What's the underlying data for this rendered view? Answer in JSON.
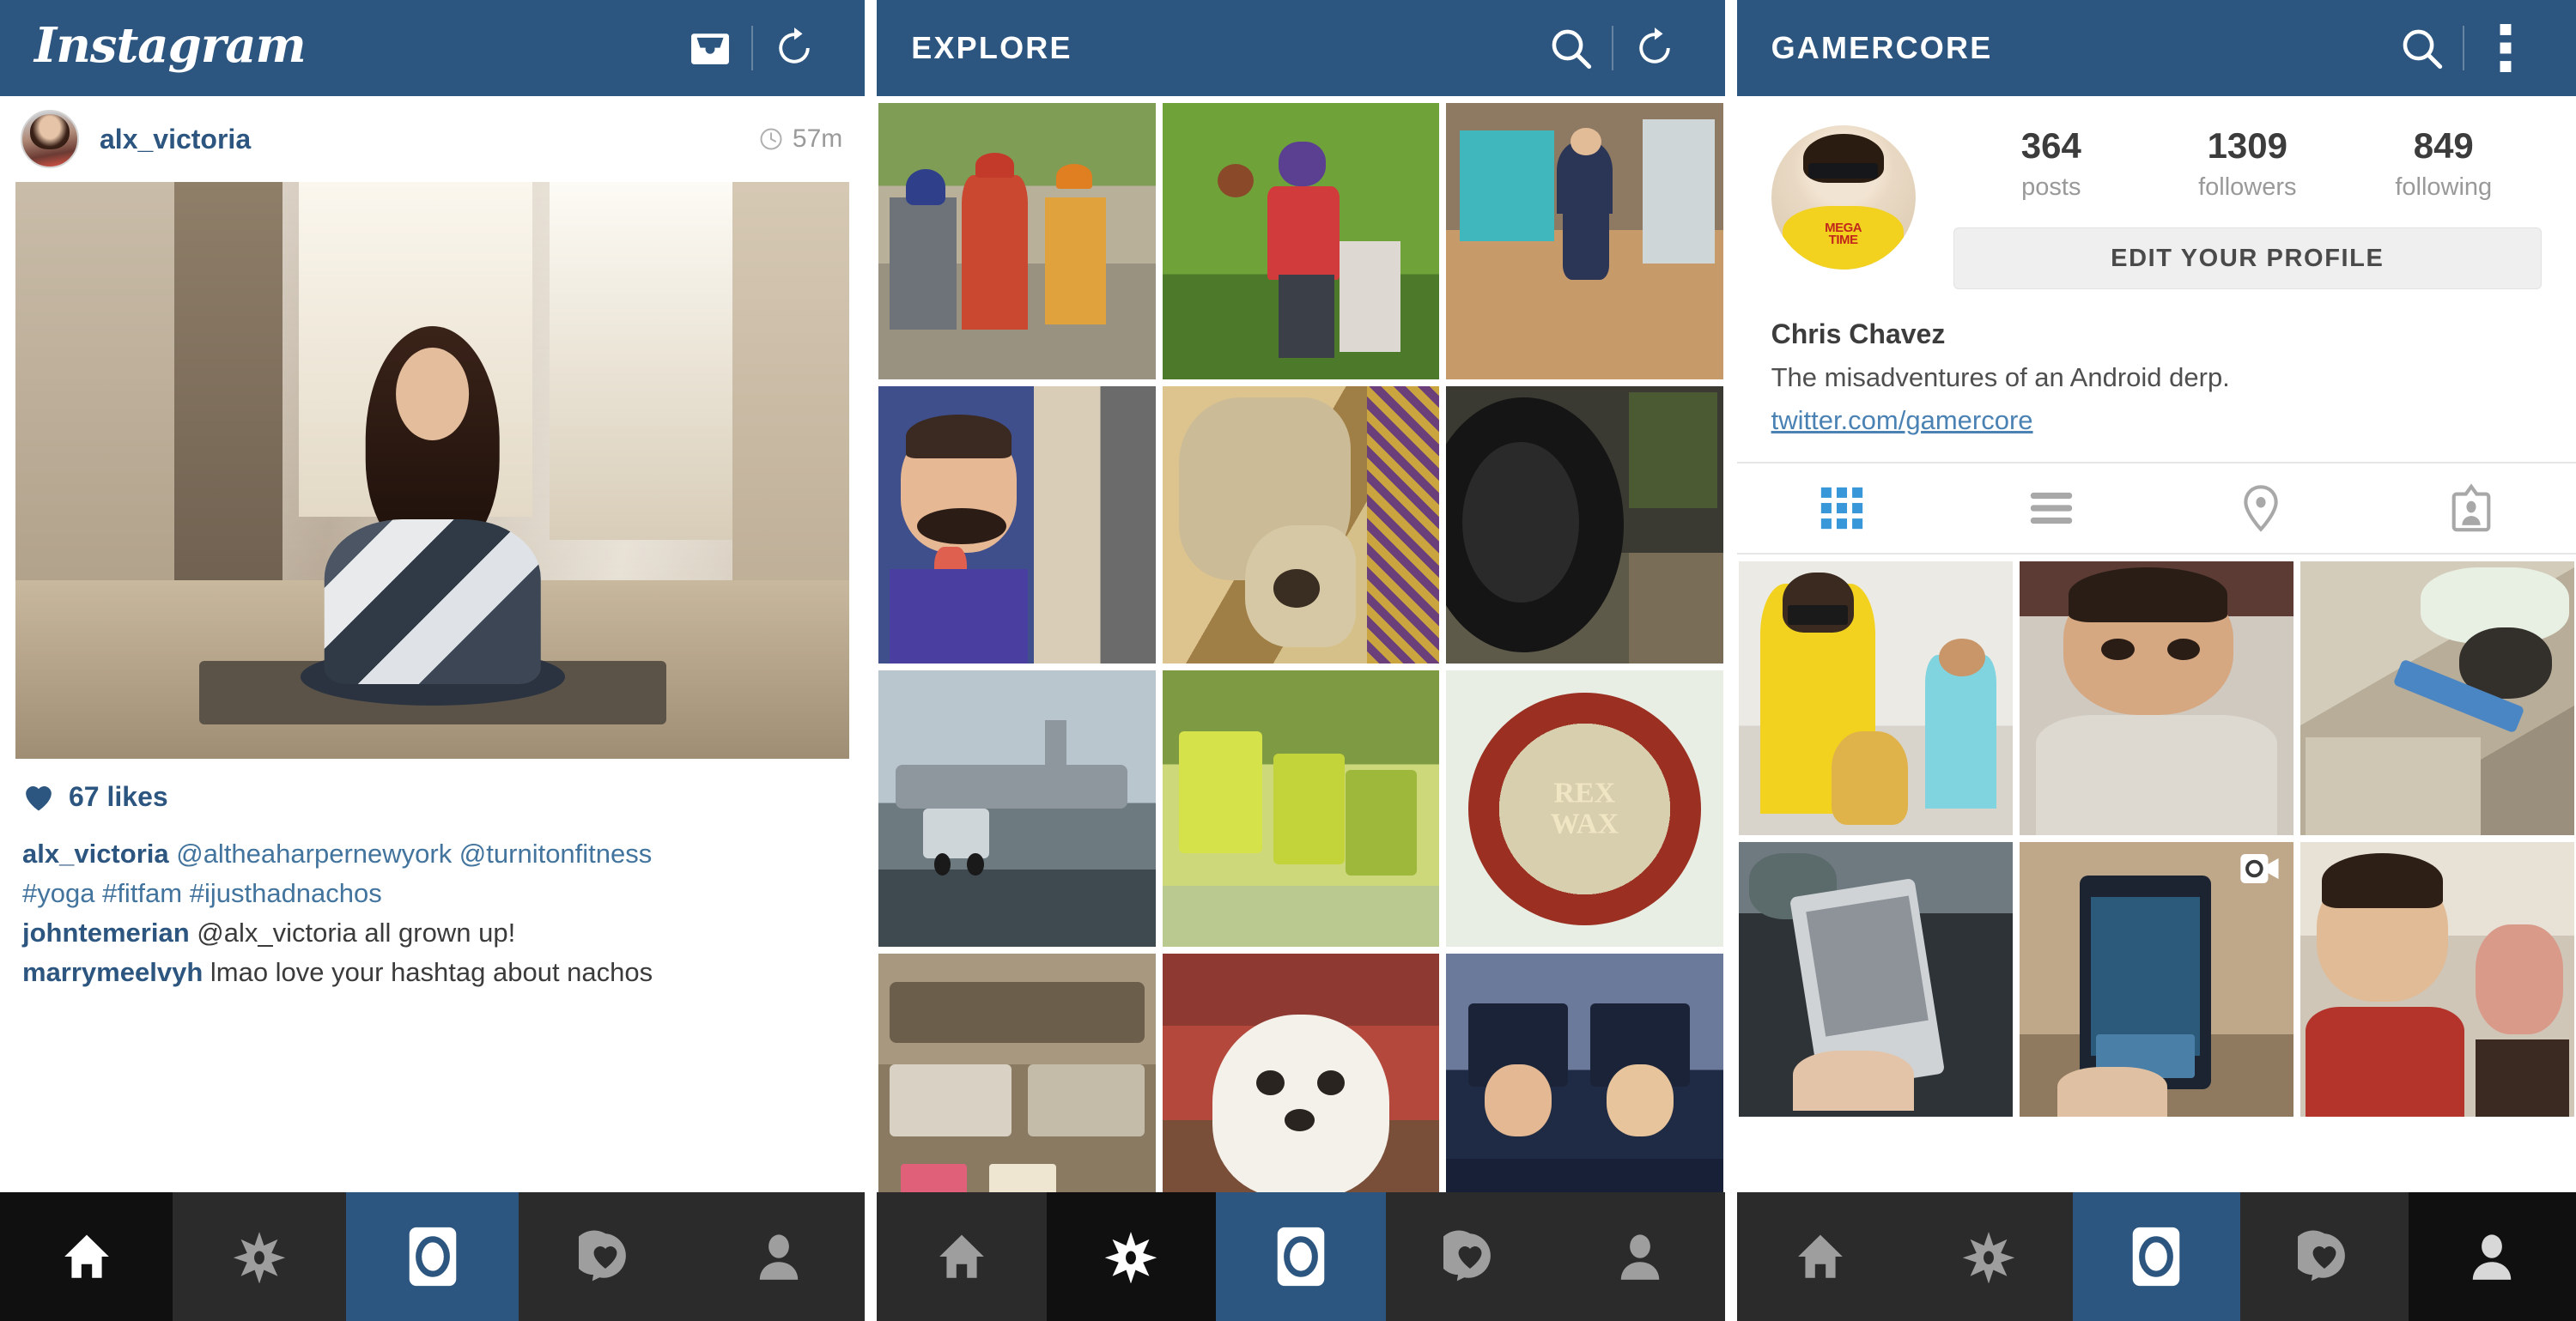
{
  "colors": {
    "appbar_blue": "#2c5680",
    "accent_blue": "#2c5680",
    "link_blue": "#4b82b4",
    "nav_dark": "#2b2b2b",
    "nav_active_dark": "#101010",
    "text_gray": "#4f4f4f",
    "muted_gray": "#999999"
  },
  "feed": {
    "appbar": {
      "logo_text": "Instagram",
      "icons": [
        {
          "name": "inbox-icon",
          "label": "Inbox"
        },
        {
          "name": "refresh-icon",
          "label": "Refresh"
        }
      ]
    },
    "post": {
      "username": "alx_victoria",
      "timestamp": "57m",
      "time_icon": "clock-icon",
      "likes": "67 likes",
      "like_icon": "heart-icon",
      "caption_lines": [
        {
          "user": "alx_victoria",
          "text": " @altheaharpernewyork @turnitonfitness"
        },
        {
          "user": "",
          "text": "#yoga #fitfam #ijusthadnachos"
        },
        {
          "user": "johntemerian",
          "text": " @alx_victoria all grown up!"
        },
        {
          "user": "marrymeelvyh",
          "text": " lmao love your hashtag about nachos"
        }
      ]
    }
  },
  "explore": {
    "appbar": {
      "title": "EXPLORE",
      "icons": [
        {
          "name": "search-icon",
          "label": "Search"
        },
        {
          "name": "refresh-icon",
          "label": "Refresh"
        }
      ]
    },
    "grid": [
      {
        "alt": "man in red shirt with two boys",
        "c1": "#7f9d55",
        "c2": "#c9482f",
        "c3": "#e0a23c"
      },
      {
        "alt": "football player throwing ball",
        "c1": "#5f9133",
        "c2": "#d23b3b",
        "c3": "#5b3f91"
      },
      {
        "alt": "woman in navy skirt by storefront",
        "c1": "#3fb7bd",
        "c2": "#2b3555",
        "c3": "#c79a6a"
      },
      {
        "alt": "man with fake moustache selfie",
        "c1": "#3f4f8c",
        "c2": "#e0c9ae",
        "c3": "#6b6b6b"
      },
      {
        "alt": "pug dog on patterned blanket",
        "c1": "#d9c08a",
        "c2": "#8a6a3a",
        "c3": "#e6d7b4"
      },
      {
        "alt": "black alloy car wheel",
        "c1": "#1c1c1c",
        "c2": "#4b5a32",
        "c3": "#6b6253"
      },
      {
        "alt": "cargo airplane on tarmac",
        "c1": "#9aa7ad",
        "c2": "#47525a",
        "c3": "#cbd3d8"
      },
      {
        "alt": "yellow-green metal patio chairs",
        "c1": "#c9d43f",
        "c2": "#6e8a3a",
        "c3": "#e4e6c9"
      },
      {
        "alt": "Rex Wax moustache wax tin",
        "c1": "#dfe6d9",
        "c2": "#9a2f22",
        "c3": "#c9a43f"
      },
      {
        "alt": "craft supplies tins on shelf",
        "c1": "#b8a88f",
        "c2": "#7a6a54",
        "c3": "#ddd2c0"
      },
      {
        "alt": "white fluffy puppy",
        "c1": "#8e3a33",
        "c2": "#f2efe8",
        "c3": "#c7bfae"
      },
      {
        "alt": "two graduates in caps",
        "c1": "#1f2a44",
        "c2": "#e0b995",
        "c3": "#5b6a85"
      }
    ]
  },
  "profile": {
    "appbar": {
      "title": "GAMERCORE",
      "icons": [
        {
          "name": "search-icon",
          "label": "Search"
        },
        {
          "name": "overflow-menu-icon",
          "label": "More options"
        }
      ]
    },
    "avatar_shirt_line1": "MEGA",
    "avatar_shirt_line2": "TIME",
    "stats": [
      {
        "value": "364",
        "label": "posts"
      },
      {
        "value": "1309",
        "label": "followers"
      },
      {
        "value": "849",
        "label": "following"
      }
    ],
    "edit_profile_label": "EDIT YOUR PROFILE",
    "name": "Chris Chavez",
    "bio": "The misadventures of an Android derp.",
    "website": "twitter.com/gamercore",
    "tabs": [
      {
        "name": "grid-tab",
        "icon": "grid-icon",
        "active": true
      },
      {
        "name": "list-tab",
        "icon": "list-icon",
        "active": false
      },
      {
        "name": "map-tab",
        "icon": "location-pin-icon",
        "active": false
      },
      {
        "name": "photos-of-you-tab",
        "icon": "person-badge-icon",
        "active": false
      }
    ],
    "grid": [
      {
        "alt": "man in yellow shirt with girl and plush",
        "c1": "#f0f0ea",
        "c2": "#f2d21f",
        "c3": "#e8b24a",
        "video": false
      },
      {
        "alt": "man in hospital gown close up",
        "c1": "#6b3a33",
        "c2": "#ddd6cd",
        "c3": "#b99a82",
        "video": false
      },
      {
        "alt": "dog on leash by flower bed",
        "c1": "#cfc6b4",
        "c2": "#3a3a3a",
        "c3": "#4b86c4",
        "video": false
      },
      {
        "alt": "hand holding HTC phone in car",
        "c1": "#3a3a3a",
        "c2": "#c9c9c9",
        "c3": "#8a8a8a",
        "video": false
      },
      {
        "alt": "hand holding Samsung phone",
        "c1": "#b49a7c",
        "c2": "#1f2b3a",
        "c3": "#d8c9b4",
        "video": true
      },
      {
        "alt": "man in red shirt in car with child",
        "c1": "#e8e2d8",
        "c2": "#b4342c",
        "c3": "#3a2a22",
        "video": false
      }
    ],
    "video_badge_icon": "video-camera-icon"
  },
  "bottom_nav": [
    {
      "name": "nav-home",
      "icon": "home-icon",
      "state": "active-dark"
    },
    {
      "name": "nav-explore",
      "icon": "compass-star-icon",
      "state": "normal"
    },
    {
      "name": "nav-camera",
      "icon": "camera-icon",
      "state": "accent"
    },
    {
      "name": "nav-activity",
      "icon": "heart-bubble-icon",
      "state": "normal"
    },
    {
      "name": "nav-profile",
      "icon": "person-icon",
      "state": "normal"
    }
  ]
}
